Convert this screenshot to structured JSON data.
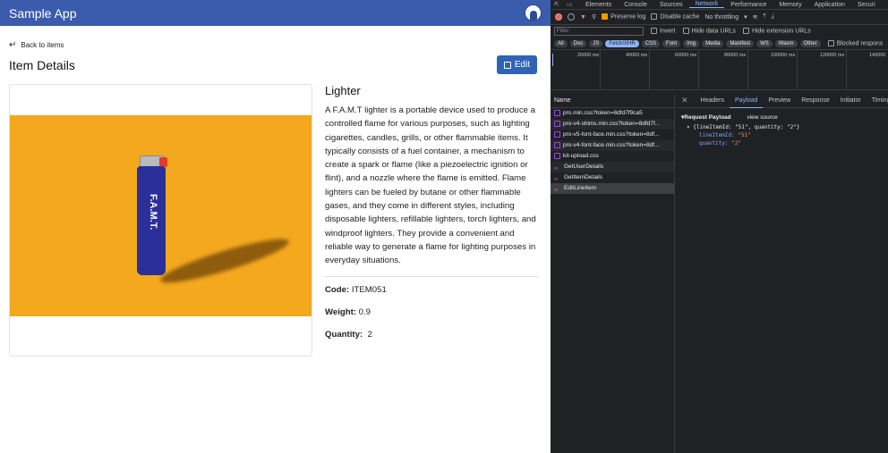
{
  "app": {
    "brand": "Sample App",
    "back_label": "Back to items",
    "page_title": "Item Details",
    "edit_label": "Edit"
  },
  "item": {
    "name": "Lighter",
    "description": "A F.A.M.T lighter is a portable device used to produce a controlled flame for various purposes, such as lighting cigarettes, candles, grills, or other flammable items. It typically consists of a fuel container, a mechanism to create a spark or flame (like a piezoelectric ignition or flint), and a nozzle where the flame is emitted. Flame lighters can be fueled by butane or other flammable gases, and they come in different styles, including disposable lighters, refillable lighters, torch lighters, and windproof lighters. They provide a convenient and reliable way to generate a flame for lighting purposes in everyday situations.",
    "code_label": "Code:",
    "code": "ITEM051",
    "weight_label": "Weight:",
    "weight": "0.9",
    "quantity_label": "Quantity:",
    "quantity": "2",
    "image_text": "F.A.M.T."
  },
  "devtools": {
    "tabs": [
      "Elements",
      "Console",
      "Sources",
      "Network",
      "Performance",
      "Memory",
      "Application",
      "Securi"
    ],
    "active_tab": "Network",
    "toolbar": {
      "preserve_log": "Preserve log",
      "disable_cache": "Disable cache",
      "throttling": "No throttling"
    },
    "filter": {
      "placeholder": "Filter",
      "invert": "Invert",
      "hide_data_urls": "Hide data URLs",
      "hide_extension_urls": "Hide extension URLs"
    },
    "types": [
      "All",
      "Doc",
      "JS",
      "Fetch/XHR",
      "CSS",
      "Font",
      "Img",
      "Media",
      "Manifest",
      "WS",
      "Wasm",
      "Other"
    ],
    "selected_type": "Fetch/XHR",
    "blocked_label": "Blocked respons",
    "timeline_ticks": [
      "20000 ms",
      "40000 ms",
      "60000 ms",
      "80000 ms",
      "100000 ms",
      "120000 ms",
      "140000"
    ],
    "name_header": "Name",
    "requests": [
      {
        "name": "pro.min.css?token=8dfd7f9ca5",
        "kind": "css"
      },
      {
        "name": "pro-v4-shims.min.css?token=8dfd7f...",
        "kind": "css"
      },
      {
        "name": "pro-v5-font-face.min.css?token=8df...",
        "kind": "css"
      },
      {
        "name": "pro-v4-font-face.min.css?token=8df...",
        "kind": "css"
      },
      {
        "name": "kit-upload.css",
        "kind": "css"
      },
      {
        "name": "GetUserDetails",
        "kind": "xhr"
      },
      {
        "name": "GetItemDetails",
        "kind": "xhr"
      },
      {
        "name": "EditLineItem",
        "kind": "xhr"
      }
    ],
    "detail_tabs": [
      "Headers",
      "Payload",
      "Preview",
      "Response",
      "Initiator",
      "Timing"
    ],
    "active_detail_tab": "Payload",
    "payload": {
      "header": "Request Payload",
      "view_source": "view source",
      "summary": "{lineItemId: \"51\", quantity: \"2\"}",
      "fields": [
        {
          "key": "lineItemId",
          "value": "\"51\""
        },
        {
          "key": "quantity",
          "value": "\"2\""
        }
      ]
    }
  }
}
